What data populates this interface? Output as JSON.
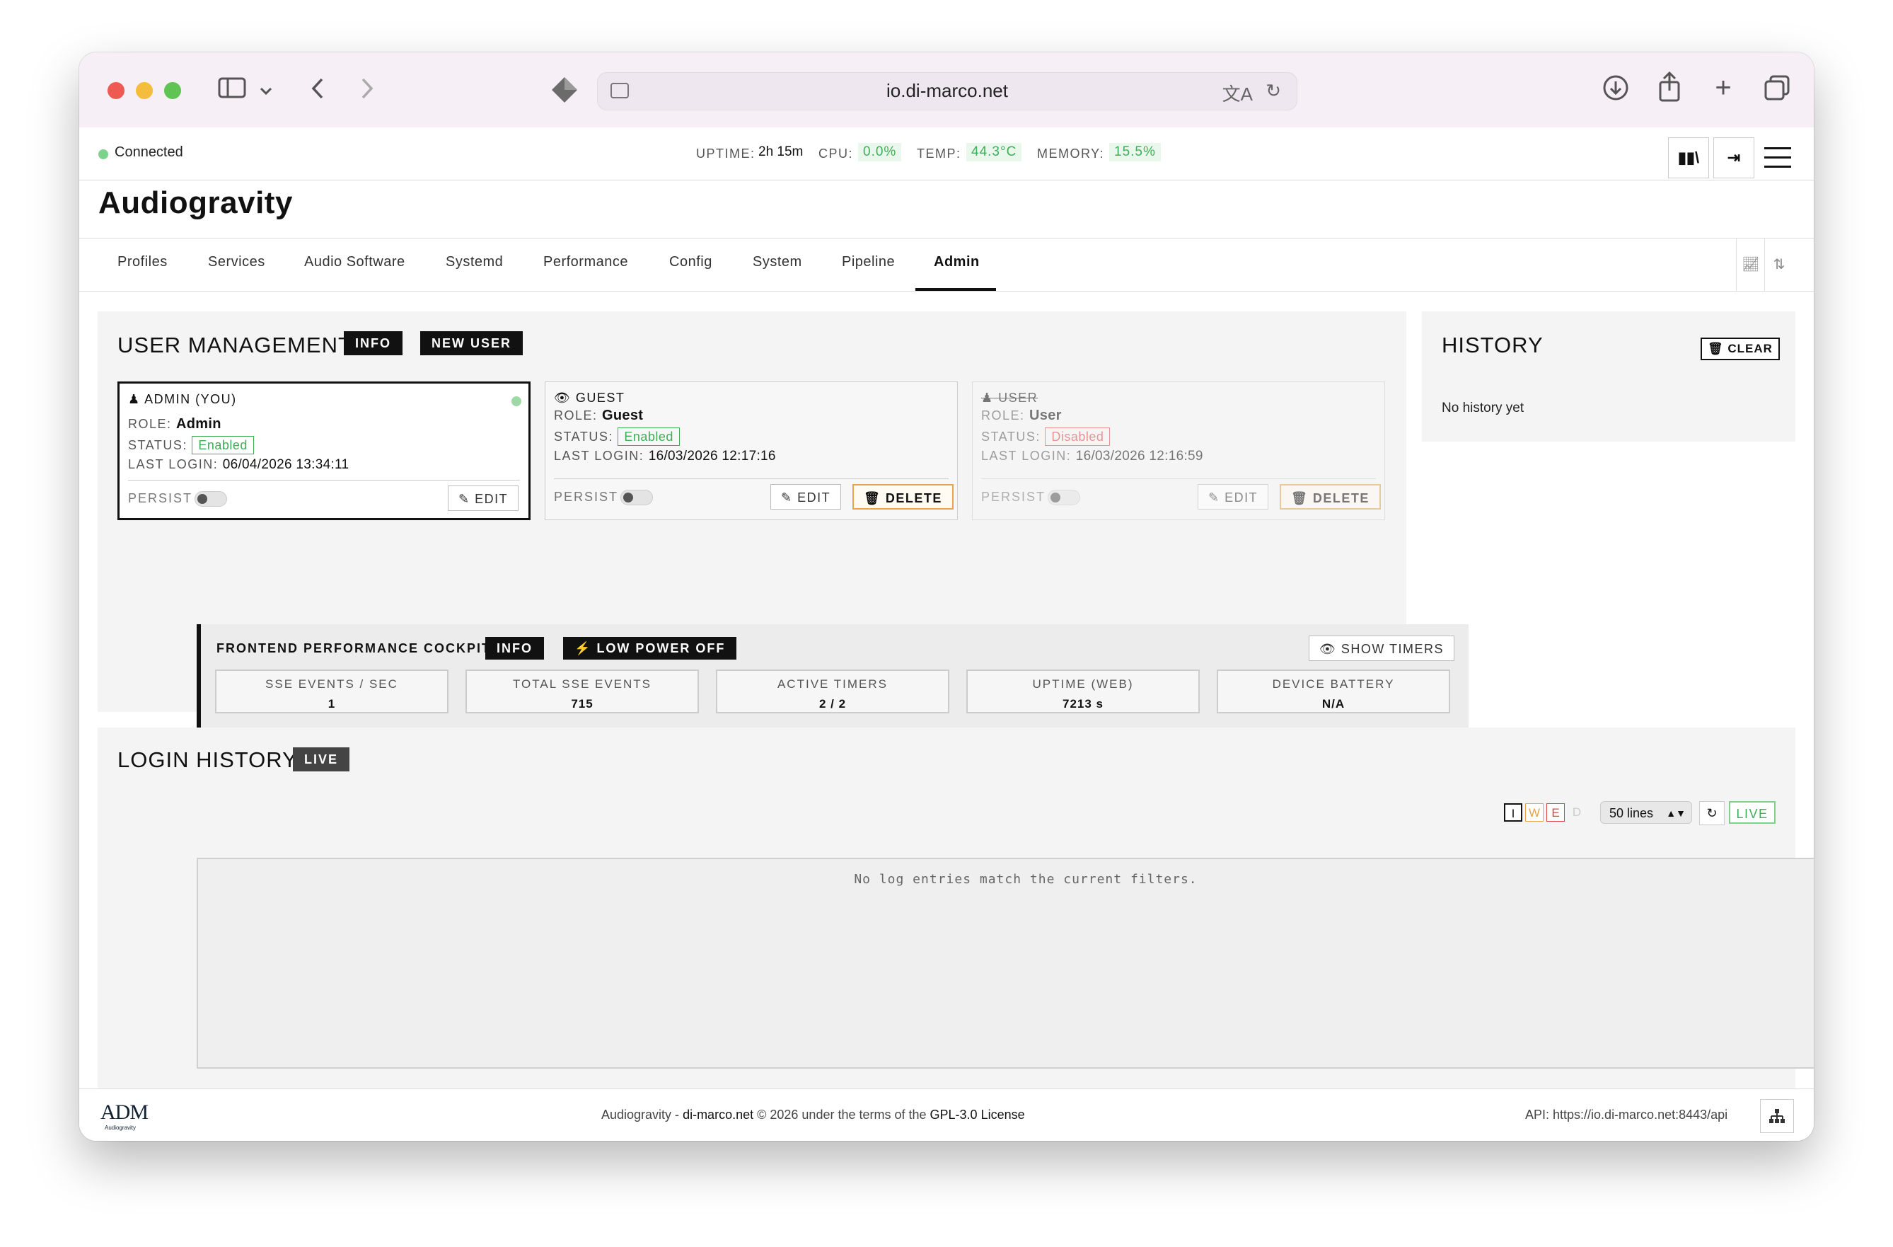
{
  "browser": {
    "url": "io.di-marco.net"
  },
  "status": {
    "connection": "Connected",
    "uptime_label": "UPTIME:",
    "uptime_value": "2h 15m",
    "cpu_label": "CPU:",
    "cpu_value": "0.0%",
    "temp_label": "TEMP:",
    "temp_value": "44.3°C",
    "memory_label": "MEMORY:",
    "memory_value": "15.5%",
    "colors": {
      "ok": "#3fae57"
    }
  },
  "brand": {
    "title": "Audiogravity"
  },
  "nav": {
    "tabs": [
      "Profiles",
      "Services",
      "Audio Software",
      "Systemd",
      "Performance",
      "Config",
      "System",
      "Pipeline",
      "Admin"
    ],
    "active": "Admin"
  },
  "user_management": {
    "title": "USER MANAGEMENT",
    "info_label": "INFO",
    "new_user_label": "NEW USER",
    "role_label": "ROLE:",
    "status_label": "STATUS:",
    "last_login_label": "LAST LOGIN:",
    "persist_label": "PERSIST",
    "edit_label": "EDIT",
    "delete_label": "DELETE",
    "users": [
      {
        "name": "ADMIN (YOU)",
        "role": "Admin",
        "status": "Enabled",
        "last_login": "06/04/2026 13:34:11"
      },
      {
        "name": "GUEST",
        "role": "Guest",
        "status": "Enabled",
        "last_login": "16/03/2026 12:17:16"
      },
      {
        "name": "USER",
        "role": "User",
        "status": "Disabled",
        "last_login": "16/03/2026 12:16:59"
      }
    ]
  },
  "history": {
    "title": "HISTORY",
    "clear_label": "CLEAR",
    "empty": "No history yet"
  },
  "cockpit": {
    "title": "FRONTEND PERFORMANCE COCKPIT",
    "info_label": "INFO",
    "low_power_label": "LOW POWER OFF",
    "show_timers_label": "SHOW TIMERS",
    "stats": [
      {
        "label": "SSE EVENTS / SEC",
        "value": "1"
      },
      {
        "label": "TOTAL SSE EVENTS",
        "value": "715"
      },
      {
        "label": "ACTIVE TIMERS",
        "value": "2 / 2"
      },
      {
        "label": "UPTIME (WEB)",
        "value": "7213 s"
      },
      {
        "label": "DEVICE BATTERY",
        "value": "N/A"
      }
    ]
  },
  "login_history": {
    "title": "LOGIN HISTORY",
    "live_badge": "LIVE",
    "levels": [
      "I",
      "W",
      "E",
      "D"
    ],
    "lines_select": "50 lines",
    "live_toggle": "LIVE",
    "empty": "No log entries match the current filters."
  },
  "footer": {
    "logo": "ADM",
    "logo_sub": "Audiogravity",
    "text_prefix": "Audiogravity - ",
    "site": "di-marco.net",
    "text_mid": " © 2026 under the terms of the ",
    "license": "GPL-3.0 License",
    "api": "API: https://io.di-marco.net:8443/api"
  }
}
